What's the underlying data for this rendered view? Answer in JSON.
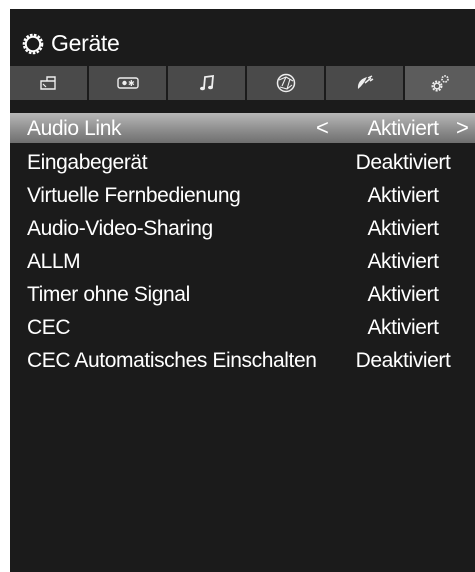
{
  "header": {
    "title": "Geräte",
    "icon": "gear-icon"
  },
  "tabs": [
    {
      "name": "picture-icon",
      "active": false
    },
    {
      "name": "sound-output-icon",
      "active": false
    },
    {
      "name": "music-note-icon",
      "active": false
    },
    {
      "name": "network-globe-icon",
      "active": false
    },
    {
      "name": "satellite-dish-icon",
      "active": false
    },
    {
      "name": "settings-gears-icon",
      "active": true
    }
  ],
  "settings": [
    {
      "label": "Audio Link",
      "value": "Aktiviert",
      "selected": true,
      "arrow_left": "<",
      "arrow_right": ">"
    },
    {
      "label": "Eingabegerät",
      "value": "Deaktiviert"
    },
    {
      "label": "Virtuelle Fernbedienung",
      "value": "Aktiviert"
    },
    {
      "label": "Audio-Video-Sharing",
      "value": "Aktiviert"
    },
    {
      "label": "ALLM",
      "value": "Aktiviert"
    },
    {
      "label": "Timer ohne Signal",
      "value": "Aktiviert"
    },
    {
      "label": "CEC",
      "value": "Aktiviert"
    },
    {
      "label": "CEC Automatisches Einschalten",
      "value": "Deaktiviert"
    }
  ]
}
